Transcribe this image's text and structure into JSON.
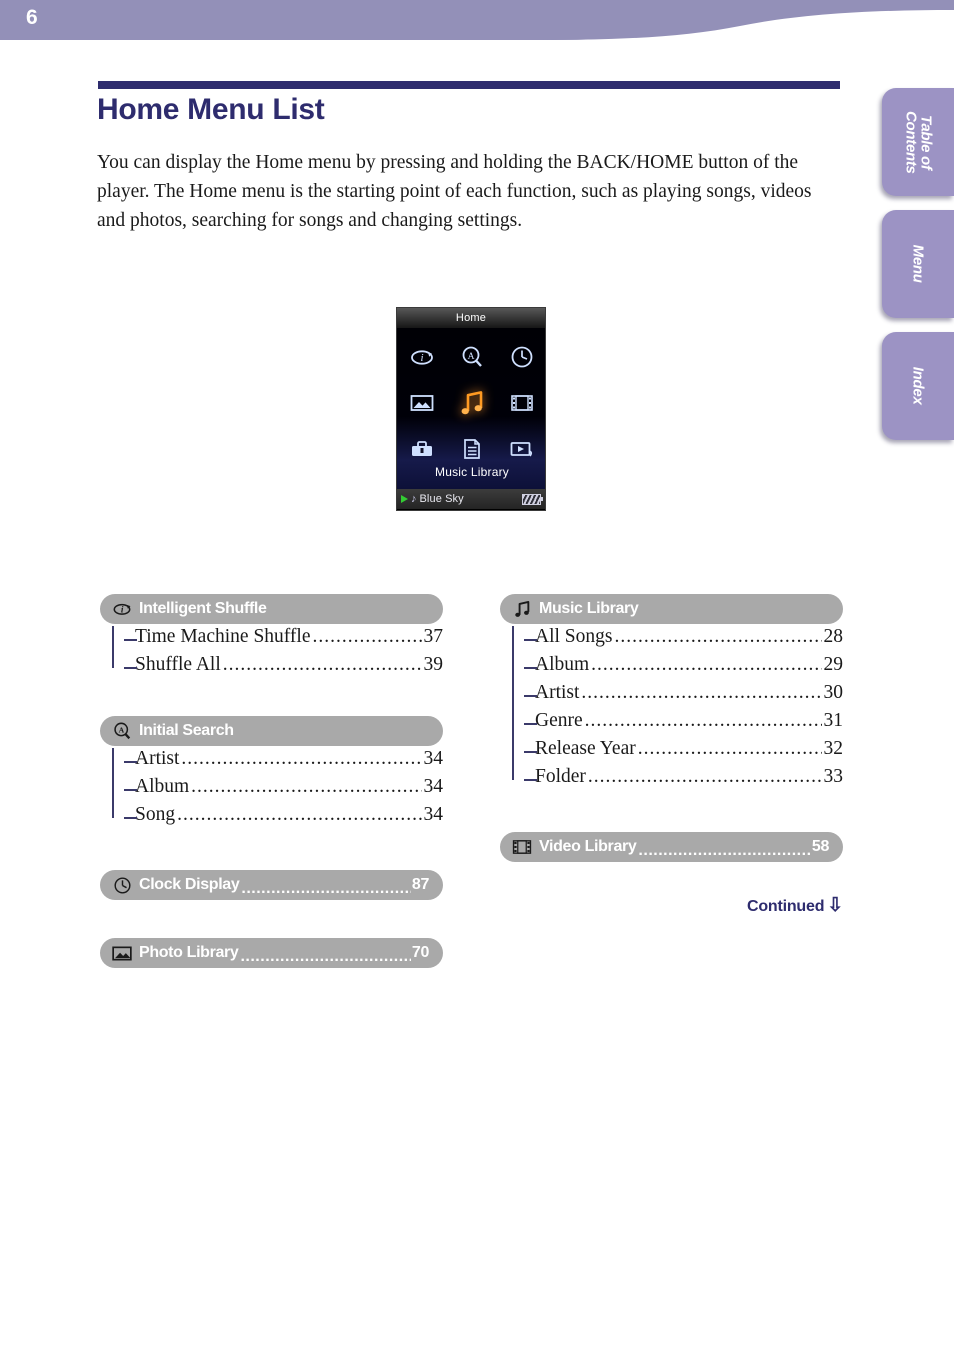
{
  "header": {
    "page_number": "6",
    "band_color": "#9390b8"
  },
  "side_tabs": [
    {
      "label": "Table of\nContents",
      "line1": "Table of",
      "line2": "Contents",
      "name": "table-of-contents"
    },
    {
      "label": "Menu",
      "line1": "Menu",
      "line2": "",
      "name": "menu"
    },
    {
      "label": "Index",
      "line1": "Index",
      "line2": "",
      "name": "index"
    }
  ],
  "title": "Home Menu List",
  "intro": "You can display the Home menu by pressing and holding the BACK/HOME button of the player. The Home menu is the starting point of each function, such as playing songs, videos and photos, searching for songs and changing settings.",
  "device": {
    "titlebar": "Home",
    "selected_label": "Music Library",
    "status_track": "Blue Sky",
    "icons": [
      {
        "name": "intelligent-shuffle-icon",
        "selected": false
      },
      {
        "name": "initial-search-icon",
        "selected": false
      },
      {
        "name": "clock-display-icon",
        "selected": false
      },
      {
        "name": "photo-library-icon",
        "selected": false
      },
      {
        "name": "music-library-icon",
        "selected": true
      },
      {
        "name": "video-library-icon",
        "selected": false
      },
      {
        "name": "settings-icon",
        "selected": false
      },
      {
        "name": "playlists-icon",
        "selected": false
      },
      {
        "name": "now-playing-icon",
        "selected": false
      }
    ]
  },
  "left_column": [
    {
      "icon": "intelligent-shuffle-icon",
      "title": "Intelligent Shuffle",
      "page": "",
      "items": [
        {
          "label": "Time Machine Shuffle",
          "page": "37"
        },
        {
          "label": "Shuffle All",
          "page": "39"
        }
      ]
    },
    {
      "icon": "initial-search-icon",
      "title": "Initial Search",
      "page": "",
      "items": [
        {
          "label": "Artist",
          "page": "34"
        },
        {
          "label": "Album",
          "page": "34"
        },
        {
          "label": "Song",
          "page": "34"
        }
      ]
    },
    {
      "icon": "clock-display-icon",
      "title": "Clock Display",
      "page": "87",
      "items": []
    },
    {
      "icon": "photo-library-icon",
      "title": "Photo Library",
      "page": "70",
      "items": []
    }
  ],
  "right_column": [
    {
      "icon": "music-library-icon",
      "title": "Music Library",
      "page": "",
      "items": [
        {
          "label": "All Songs",
          "page": "28"
        },
        {
          "label": "Album",
          "page": "29"
        },
        {
          "label": "Artist",
          "page": "30"
        },
        {
          "label": "Genre",
          "page": "31"
        },
        {
          "label": "Release Year",
          "page": "32"
        },
        {
          "label": "Folder",
          "page": "33"
        }
      ]
    },
    {
      "icon": "video-library-icon",
      "title": "Video Library",
      "page": "58",
      "items": []
    }
  ],
  "continued": {
    "label": "Continued",
    "arrow": "⇩"
  },
  "colors": {
    "accent_navy": "#2e2c6e",
    "band_purple": "#9390b8",
    "tab_purple": "#9c93c4",
    "group_gray": "#a9a9a9",
    "tree_line": "#3b3a6a"
  }
}
